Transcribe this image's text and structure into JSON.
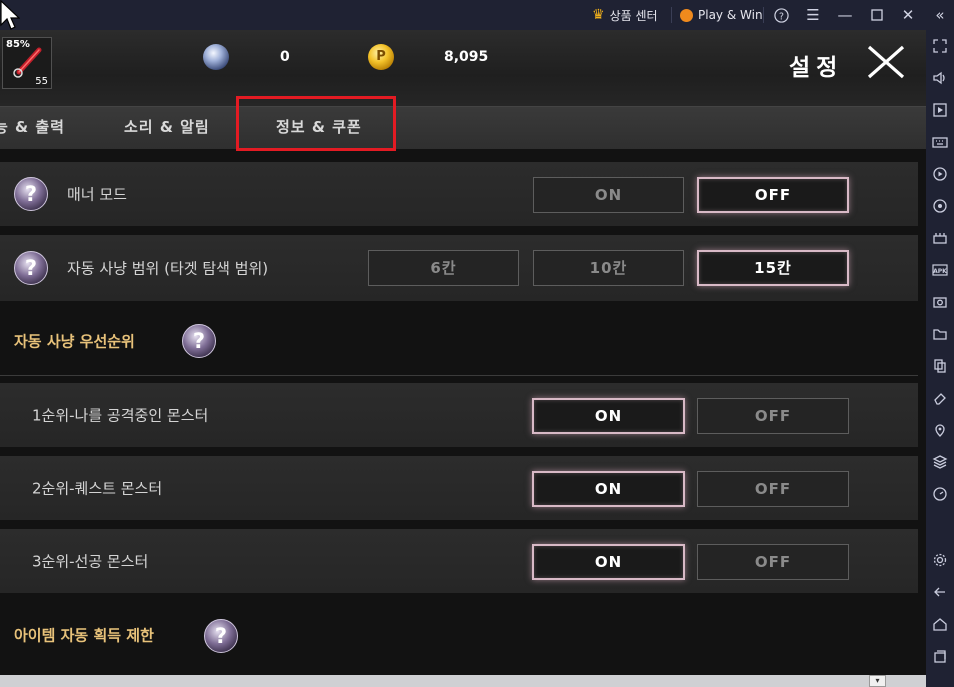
{
  "titlebar": {
    "store_label": "상품 센터",
    "play_win_label": "Play & Win",
    "help_icon": "question-circle-icon",
    "menu_icon": "hamburger-icon",
    "minimize_icon": "minimize-icon",
    "maximize_icon": "maximize-icon",
    "close_icon": "close-icon",
    "collapse_icon": "double-chevron-left-icon"
  },
  "header": {
    "avatar_percent": "85%",
    "avatar_level": "55",
    "diamond_count": "0",
    "gold_count": "8,095",
    "gold_symbol": "P",
    "title": "설정"
  },
  "tabs": [
    {
      "label": "능 & 출력"
    },
    {
      "label": "소리 & 알림"
    },
    {
      "label": "정보 & 쿠폰"
    }
  ],
  "settings": {
    "manner_mode": {
      "label": "매너 모드",
      "options": [
        "ON",
        "OFF"
      ],
      "selected": "OFF"
    },
    "auto_hunt_range": {
      "label": "자동 사냥 범위 (타겟 탐색 범위)",
      "options": [
        "6칸",
        "10칸",
        "15칸"
      ],
      "selected": "15칸"
    },
    "priority_group": {
      "label": "자동 사냥 우선순위"
    },
    "priorities": [
      {
        "label": "1순위-나를 공격중인 몬스터",
        "on": "ON",
        "off": "OFF",
        "selected": "ON"
      },
      {
        "label": "2순위-퀘스트 몬스터",
        "on": "ON",
        "off": "OFF",
        "selected": "ON"
      },
      {
        "label": "3순위-선공 몬스터",
        "on": "ON",
        "off": "OFF",
        "selected": "ON"
      }
    ],
    "item_group": {
      "label": "아이템 자동 획득 제한"
    }
  },
  "help_glyph": "?",
  "sidebar_icons": [
    "fullscreen-icon",
    "volume-icon",
    "macro-icon",
    "keyboard-icon",
    "record-icon",
    "rotate-icon",
    "multi-instance-icon",
    "apk-icon",
    "screenshot-icon",
    "folder-icon",
    "copy-icon",
    "erase-icon",
    "location-icon",
    "layers-icon",
    "speed-icon",
    "settings-icon",
    "back-icon",
    "home-icon",
    "recent-apps-icon"
  ],
  "colors": {
    "titlebar_bg": "#1f2233",
    "group_label": "#e8c27a",
    "active_border": "#d8b9c6",
    "highlight_red": "#e31b23"
  }
}
